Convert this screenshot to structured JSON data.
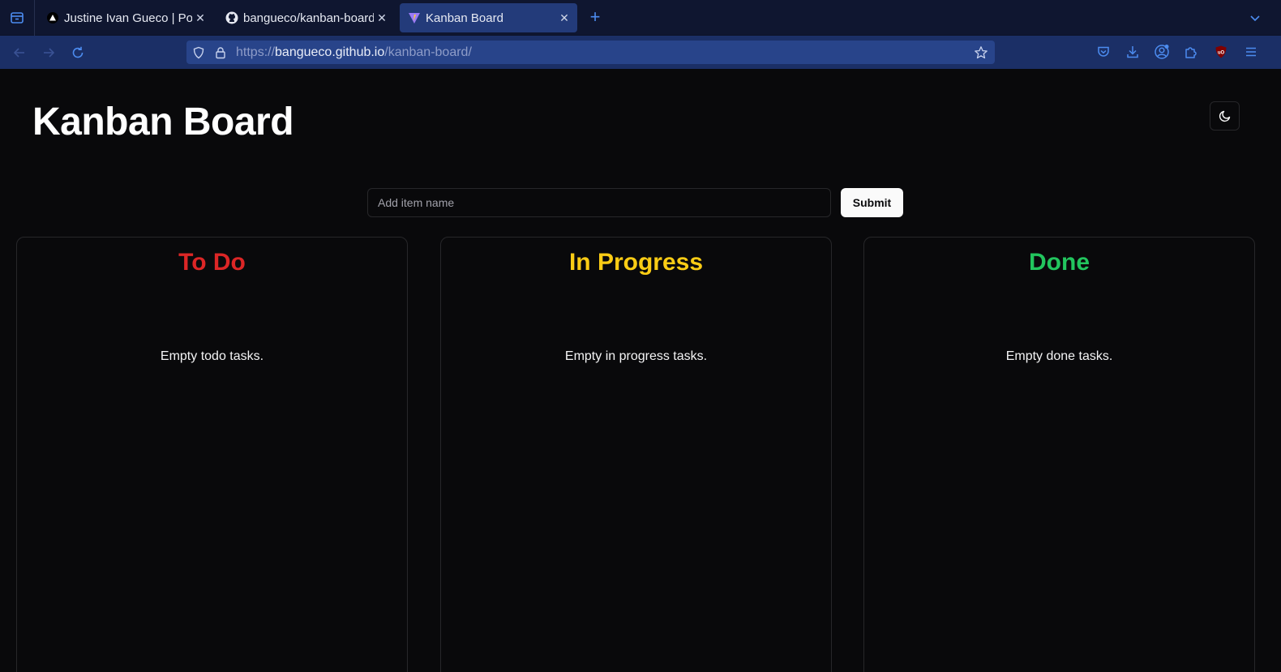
{
  "browser": {
    "tabs": [
      {
        "title": "Justine Ivan Gueco | Portfolio",
        "icon": "triangle-icon",
        "active": false
      },
      {
        "title": "bangueco/kanban-board",
        "icon": "github-icon",
        "active": false
      },
      {
        "title": "Kanban Board",
        "icon": "vite-icon",
        "active": true
      }
    ],
    "url": {
      "scheme": "https://",
      "host": "bangueco.github.io",
      "path": "/kanban-board/"
    }
  },
  "page": {
    "title": "Kanban Board",
    "form": {
      "placeholder": "Add item name",
      "value": "",
      "submit_label": "Submit"
    },
    "columns": [
      {
        "title": "To Do",
        "color": "#dc2626",
        "empty_text": "Empty todo tasks."
      },
      {
        "title": "In Progress",
        "color": "#facc15",
        "empty_text": "Empty in progress tasks."
      },
      {
        "title": "Done",
        "color": "#22c55e",
        "empty_text": "Empty done tasks."
      }
    ]
  },
  "colors": {
    "chrome_bg": "#0f1630",
    "nav_bg": "#1b2f66",
    "accent": "#4c8cf0",
    "page_bg": "#09090b"
  }
}
